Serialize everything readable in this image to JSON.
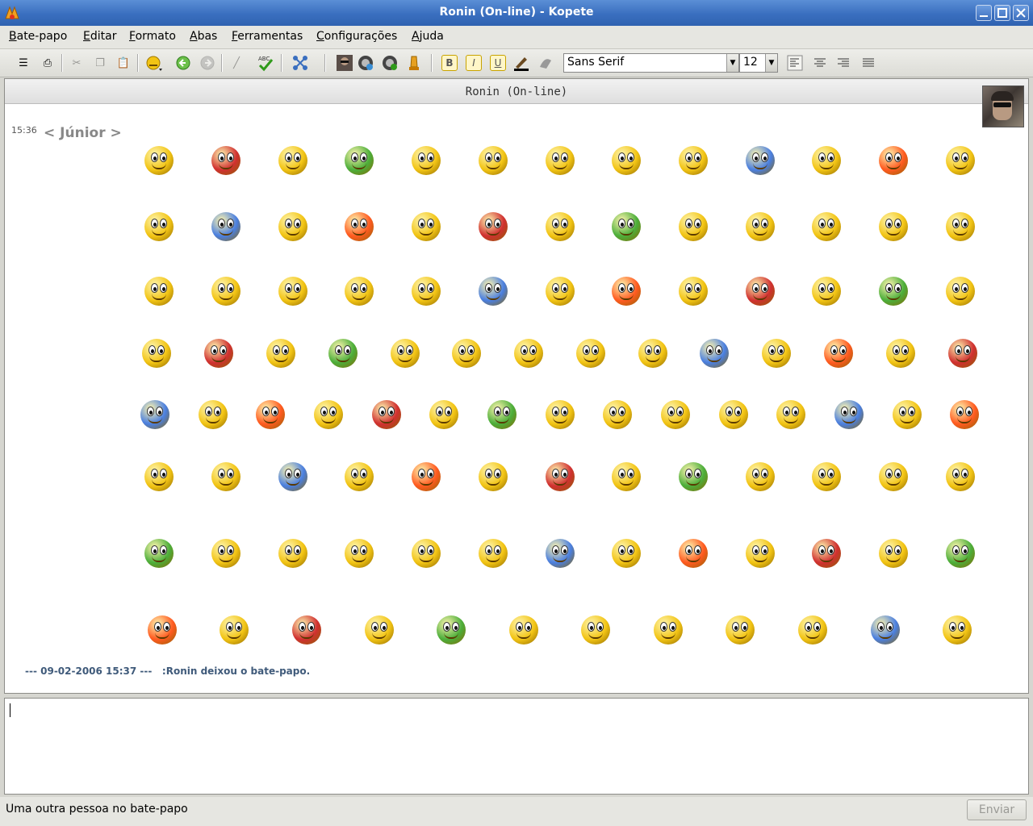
{
  "window": {
    "title": "Ronin (On-line) - Kopete"
  },
  "menubar": {
    "items": [
      {
        "mnemonic": "B",
        "rest": "ate-papo"
      },
      {
        "mnemonic": "E",
        "rest": "ditar"
      },
      {
        "mnemonic": "F",
        "rest": "ormato"
      },
      {
        "mnemonic": "A",
        "rest": "bas"
      },
      {
        "mnemonic": "F",
        "rest": "erramentas"
      },
      {
        "mnemonic": "C",
        "rest": "onfigurações"
      },
      {
        "mnemonic": "A",
        "rest": "juda"
      }
    ]
  },
  "toolbar": {
    "icons": [
      "send-file-icon",
      "print-icon",
      "cut-icon",
      "copy-icon",
      "paste-icon",
      "emoticons-icon",
      "back-icon",
      "forward-icon",
      "clear-icon",
      "spellcheck-icon",
      "invite-icon",
      "contact-photo-icon",
      "add-contact-icon",
      "contact-info-icon",
      "nudge-icon"
    ],
    "bold": "B",
    "italic": "I",
    "underline": "U",
    "font_family": "Sans Serif",
    "font_size": "12",
    "align": [
      "align-left-icon",
      "align-center-icon",
      "align-right-icon",
      "justify-icon"
    ]
  },
  "chat": {
    "contact_header": "Ronin (On-line)",
    "message_time": "15:36",
    "message_sender": "< Júnior >",
    "emoticon_rows": [
      13,
      13,
      13,
      14,
      15,
      13,
      13,
      12
    ],
    "emoticon_count": 106,
    "system_timestamp": "--- 09-02-2006 15:37 ---",
    "system_message": ":Ronin deixou o bate-papo."
  },
  "status": {
    "text": "Uma outra pessoa no bate-papo",
    "send_label": "Enviar"
  },
  "colors": {
    "titlebar": "#3a6fbf",
    "smiley": "#f2c414",
    "system_message": "#3f5a7a",
    "sender": "#888888"
  }
}
